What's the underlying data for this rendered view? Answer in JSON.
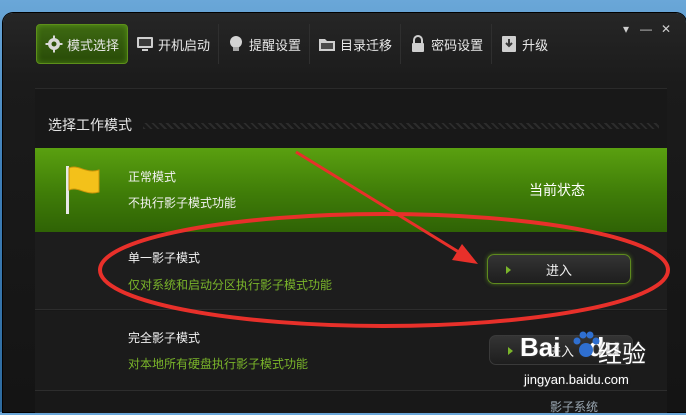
{
  "window_controls": {
    "pin": "▾",
    "minimize": "—",
    "close": "✕"
  },
  "tabs": [
    {
      "label": "模式选择",
      "icon": "gear-icon",
      "active": true
    },
    {
      "label": "开机启动",
      "icon": "monitor-icon",
      "active": false
    },
    {
      "label": "提醒设置",
      "icon": "bulb-icon",
      "active": false
    },
    {
      "label": "目录迁移",
      "icon": "folder-icon",
      "active": false
    },
    {
      "label": "密码设置",
      "icon": "lock-icon",
      "active": false
    },
    {
      "label": "升级",
      "icon": "download-icon",
      "active": false
    }
  ],
  "panel": {
    "title": "选择工作模式"
  },
  "modes": [
    {
      "title": "正常模式",
      "desc": "不执行影子模式功能",
      "status": "当前状态",
      "selected": true
    },
    {
      "title": "单一影子模式",
      "desc": "仅对系统和启动分区执行影子模式功能",
      "button": "进入"
    },
    {
      "title": "完全影子模式",
      "desc": "对本地所有硬盘执行影子模式功能",
      "button": "进入"
    }
  ],
  "watermark": {
    "brand_a": "Bai",
    "brand_b": "du",
    "brand_cn": "经验",
    "url": "jingyan.baidu.com",
    "sub": "影子系统"
  },
  "colors": {
    "accent_green": "#7ab52a",
    "selected_row": "#4a8c0a",
    "annotation_red": "#e8302a"
  }
}
